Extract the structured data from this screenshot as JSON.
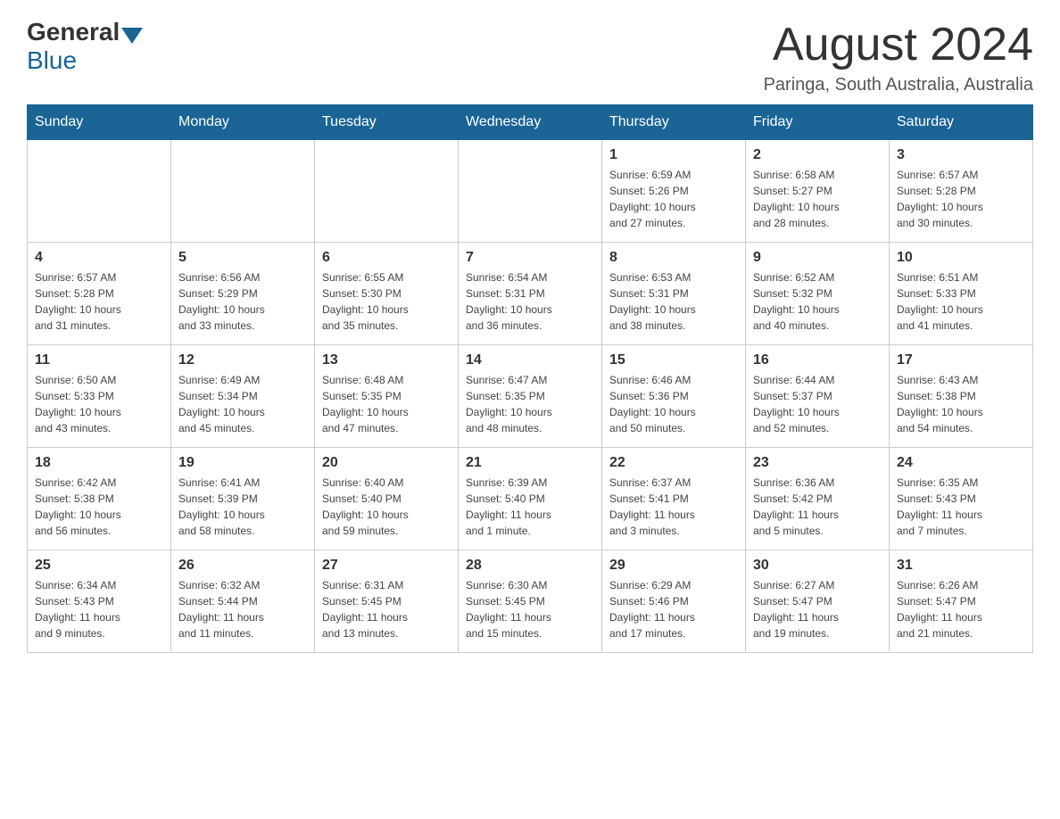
{
  "header": {
    "logo_general": "General",
    "logo_blue": "Blue",
    "month_title": "August 2024",
    "location": "Paringa, South Australia, Australia"
  },
  "calendar": {
    "days_of_week": [
      "Sunday",
      "Monday",
      "Tuesday",
      "Wednesday",
      "Thursday",
      "Friday",
      "Saturday"
    ],
    "weeks": [
      [
        {
          "day": "",
          "info": ""
        },
        {
          "day": "",
          "info": ""
        },
        {
          "day": "",
          "info": ""
        },
        {
          "day": "",
          "info": ""
        },
        {
          "day": "1",
          "info": "Sunrise: 6:59 AM\nSunset: 5:26 PM\nDaylight: 10 hours\nand 27 minutes."
        },
        {
          "day": "2",
          "info": "Sunrise: 6:58 AM\nSunset: 5:27 PM\nDaylight: 10 hours\nand 28 minutes."
        },
        {
          "day": "3",
          "info": "Sunrise: 6:57 AM\nSunset: 5:28 PM\nDaylight: 10 hours\nand 30 minutes."
        }
      ],
      [
        {
          "day": "4",
          "info": "Sunrise: 6:57 AM\nSunset: 5:28 PM\nDaylight: 10 hours\nand 31 minutes."
        },
        {
          "day": "5",
          "info": "Sunrise: 6:56 AM\nSunset: 5:29 PM\nDaylight: 10 hours\nand 33 minutes."
        },
        {
          "day": "6",
          "info": "Sunrise: 6:55 AM\nSunset: 5:30 PM\nDaylight: 10 hours\nand 35 minutes."
        },
        {
          "day": "7",
          "info": "Sunrise: 6:54 AM\nSunset: 5:31 PM\nDaylight: 10 hours\nand 36 minutes."
        },
        {
          "day": "8",
          "info": "Sunrise: 6:53 AM\nSunset: 5:31 PM\nDaylight: 10 hours\nand 38 minutes."
        },
        {
          "day": "9",
          "info": "Sunrise: 6:52 AM\nSunset: 5:32 PM\nDaylight: 10 hours\nand 40 minutes."
        },
        {
          "day": "10",
          "info": "Sunrise: 6:51 AM\nSunset: 5:33 PM\nDaylight: 10 hours\nand 41 minutes."
        }
      ],
      [
        {
          "day": "11",
          "info": "Sunrise: 6:50 AM\nSunset: 5:33 PM\nDaylight: 10 hours\nand 43 minutes."
        },
        {
          "day": "12",
          "info": "Sunrise: 6:49 AM\nSunset: 5:34 PM\nDaylight: 10 hours\nand 45 minutes."
        },
        {
          "day": "13",
          "info": "Sunrise: 6:48 AM\nSunset: 5:35 PM\nDaylight: 10 hours\nand 47 minutes."
        },
        {
          "day": "14",
          "info": "Sunrise: 6:47 AM\nSunset: 5:35 PM\nDaylight: 10 hours\nand 48 minutes."
        },
        {
          "day": "15",
          "info": "Sunrise: 6:46 AM\nSunset: 5:36 PM\nDaylight: 10 hours\nand 50 minutes."
        },
        {
          "day": "16",
          "info": "Sunrise: 6:44 AM\nSunset: 5:37 PM\nDaylight: 10 hours\nand 52 minutes."
        },
        {
          "day": "17",
          "info": "Sunrise: 6:43 AM\nSunset: 5:38 PM\nDaylight: 10 hours\nand 54 minutes."
        }
      ],
      [
        {
          "day": "18",
          "info": "Sunrise: 6:42 AM\nSunset: 5:38 PM\nDaylight: 10 hours\nand 56 minutes."
        },
        {
          "day": "19",
          "info": "Sunrise: 6:41 AM\nSunset: 5:39 PM\nDaylight: 10 hours\nand 58 minutes."
        },
        {
          "day": "20",
          "info": "Sunrise: 6:40 AM\nSunset: 5:40 PM\nDaylight: 10 hours\nand 59 minutes."
        },
        {
          "day": "21",
          "info": "Sunrise: 6:39 AM\nSunset: 5:40 PM\nDaylight: 11 hours\nand 1 minute."
        },
        {
          "day": "22",
          "info": "Sunrise: 6:37 AM\nSunset: 5:41 PM\nDaylight: 11 hours\nand 3 minutes."
        },
        {
          "day": "23",
          "info": "Sunrise: 6:36 AM\nSunset: 5:42 PM\nDaylight: 11 hours\nand 5 minutes."
        },
        {
          "day": "24",
          "info": "Sunrise: 6:35 AM\nSunset: 5:43 PM\nDaylight: 11 hours\nand 7 minutes."
        }
      ],
      [
        {
          "day": "25",
          "info": "Sunrise: 6:34 AM\nSunset: 5:43 PM\nDaylight: 11 hours\nand 9 minutes."
        },
        {
          "day": "26",
          "info": "Sunrise: 6:32 AM\nSunset: 5:44 PM\nDaylight: 11 hours\nand 11 minutes."
        },
        {
          "day": "27",
          "info": "Sunrise: 6:31 AM\nSunset: 5:45 PM\nDaylight: 11 hours\nand 13 minutes."
        },
        {
          "day": "28",
          "info": "Sunrise: 6:30 AM\nSunset: 5:45 PM\nDaylight: 11 hours\nand 15 minutes."
        },
        {
          "day": "29",
          "info": "Sunrise: 6:29 AM\nSunset: 5:46 PM\nDaylight: 11 hours\nand 17 minutes."
        },
        {
          "day": "30",
          "info": "Sunrise: 6:27 AM\nSunset: 5:47 PM\nDaylight: 11 hours\nand 19 minutes."
        },
        {
          "day": "31",
          "info": "Sunrise: 6:26 AM\nSunset: 5:47 PM\nDaylight: 11 hours\nand 21 minutes."
        }
      ]
    ]
  }
}
